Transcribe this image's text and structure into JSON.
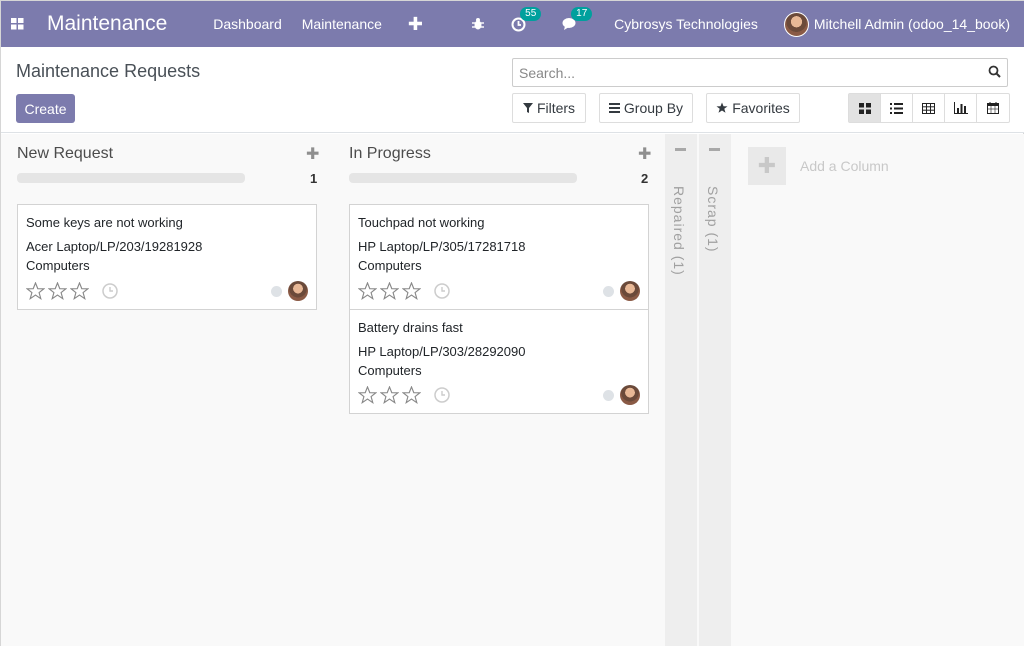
{
  "navbar": {
    "app_name": "Maintenance",
    "menu": [
      "Dashboard",
      "Maintenance"
    ],
    "activity_count": "55",
    "message_count": "17",
    "company": "Cybrosys Technologies",
    "user": "Mitchell Admin (odoo_14_book)"
  },
  "control": {
    "title": "Maintenance Requests",
    "create_label": "Create",
    "search_placeholder": "Search...",
    "filters_label": "Filters",
    "groupby_label": "Group By",
    "favorites_label": "Favorites"
  },
  "columns": [
    {
      "title": "New Request",
      "count": "1",
      "cards": [
        {
          "title": "Some keys are not working",
          "equipment": "Acer Laptop/LP/203/19281928",
          "category": "Computers"
        }
      ]
    },
    {
      "title": "In Progress",
      "count": "2",
      "cards": [
        {
          "title": "Touchpad not working",
          "equipment": "HP Laptop/LP/305/17281718",
          "category": "Computers"
        },
        {
          "title": "Battery drains fast",
          "equipment": "HP Laptop/LP/303/28292090",
          "category": "Computers"
        }
      ]
    }
  ],
  "folded_columns": [
    "Repaired (1)",
    "Scrap (1)"
  ],
  "add_column_label": "Add a Column",
  "colors": {
    "brand": "#7c7bad",
    "badge": "#00a09d"
  }
}
